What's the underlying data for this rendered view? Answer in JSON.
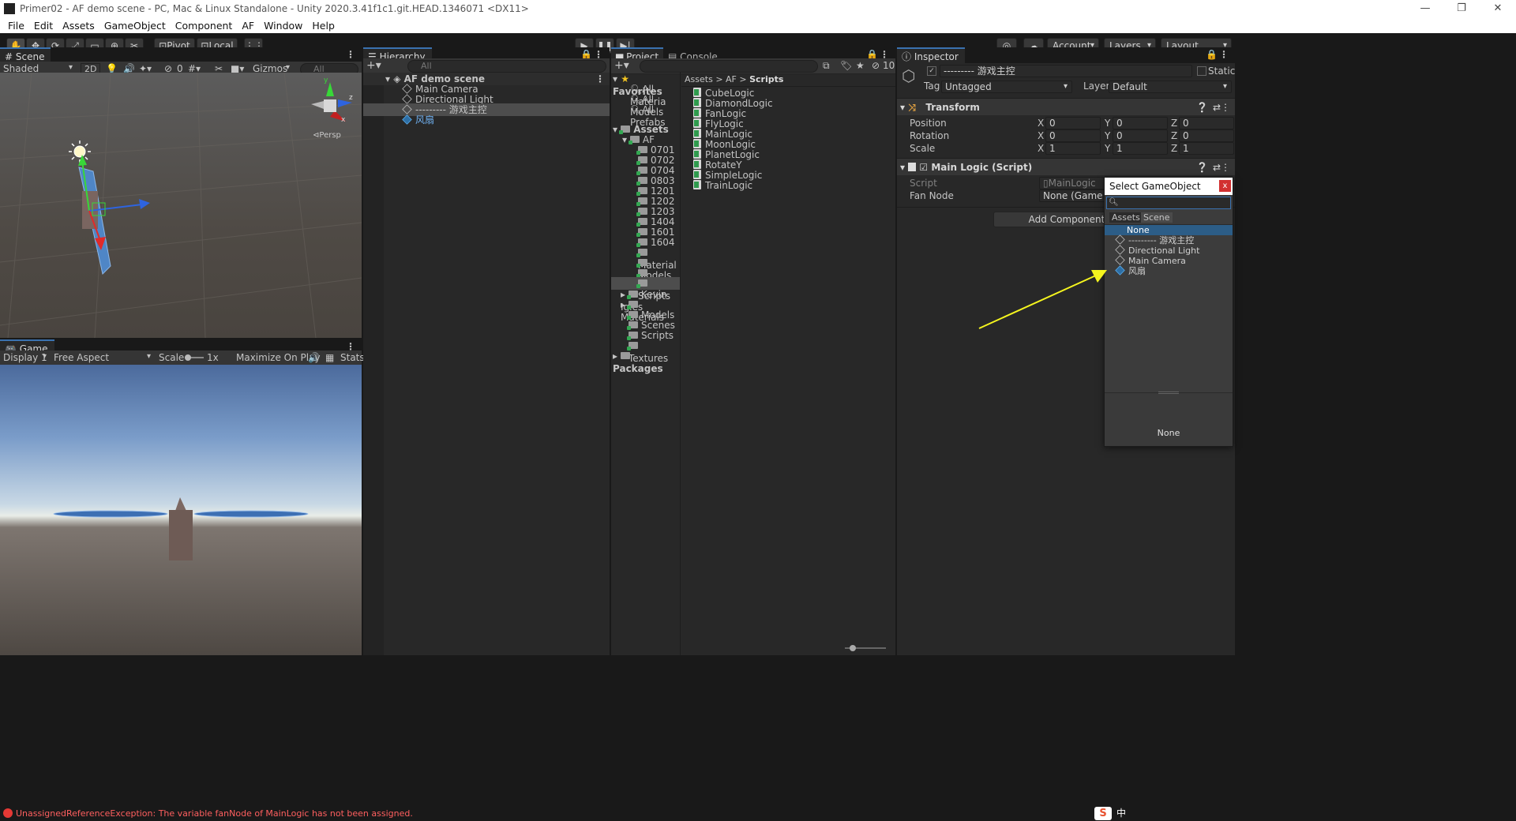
{
  "window": {
    "title": "Primer02 - AF demo scene - PC, Mac & Linux Standalone - Unity 2020.3.41f1c1.git.HEAD.1346071 <DX11>",
    "controls": [
      "—",
      "❐",
      "✕"
    ]
  },
  "menu": [
    "File",
    "Edit",
    "Assets",
    "GameObject",
    "Component",
    "AF",
    "Window",
    "Help"
  ],
  "toolbar": {
    "pivot": "Pivot",
    "local": "Local",
    "account": "Account",
    "layers": "Layers",
    "layout": "Layout"
  },
  "scene": {
    "tab": "Scene",
    "shading": "Shaded",
    "mode_2d": "2D",
    "hidden_count": "0",
    "gizmos": "Gizmos",
    "search_placeholder": "All",
    "persp": "Persp",
    "axes": {
      "y": "y",
      "x": "x",
      "z": "z"
    }
  },
  "game": {
    "tab": "Game",
    "display": "Display 1",
    "aspect": "Free Aspect",
    "scale_label": "Scale",
    "scale_value": "1x",
    "maximize": "Maximize On Play",
    "stats": "Stats"
  },
  "hierarchy": {
    "tab": "Hierarchy",
    "search_placeholder": "All",
    "scene_name": "AF demo scene",
    "items": [
      "Main Camera",
      "Directional Light",
      "--------- 游戏主控",
      "风扇"
    ]
  },
  "project": {
    "tab": "Project",
    "console_tab": "Console",
    "hidden_count": "10",
    "favorites_label": "Favorites",
    "favorites": [
      "All Materia",
      "All Models",
      "All Prefabs"
    ],
    "assets_label": "Assets",
    "af_label": "AF",
    "af_folders": [
      "0701",
      "0702",
      "0704",
      "0803",
      "1201",
      "1202",
      "1203",
      "1404",
      "1601",
      "1604",
      "Material",
      "Models",
      "Scenes",
      "Scripts"
    ],
    "asset_folders": [
      "Kevin Igles",
      "Materials",
      "Models",
      "Scenes",
      "Scripts",
      "Textures"
    ],
    "packages_label": "Packages",
    "breadcrumb": [
      "Assets",
      "AF",
      "Scripts"
    ],
    "breadcrumb_sep": ">",
    "files": [
      "CubeLogic",
      "DiamondLogic",
      "FanLogic",
      "FlyLogic",
      "MainLogic",
      "MoonLogic",
      "PlanetLogic",
      "RotateY",
      "SimpleLogic",
      "TrainLogic"
    ]
  },
  "inspector": {
    "tab": "Inspector",
    "object_name": "--------- 游戏主控",
    "static_label": "Static",
    "tag_label": "Tag",
    "tag_value": "Untagged",
    "layer_label": "Layer",
    "layer_value": "Default",
    "transform": {
      "title": "Transform",
      "position_label": "Position",
      "rotation_label": "Rotation",
      "scale_label": "Scale",
      "position": {
        "x": "0",
        "y": "0",
        "z": "0"
      },
      "rotation": {
        "x": "0",
        "y": "0",
        "z": "0"
      },
      "scale": {
        "x": "1",
        "y": "1",
        "z": "1"
      },
      "axis_x": "X",
      "axis_y": "Y",
      "axis_z": "Z"
    },
    "script_component": {
      "title": "Main Logic (Script)",
      "script_label": "Script",
      "script_value": "MainLogic",
      "fan_node_label": "Fan Node",
      "fan_node_value": "None (Game Obje"
    },
    "add_component": "Add Component"
  },
  "popup": {
    "title": "Select GameObject",
    "close": "x",
    "tabs": [
      "Assets",
      "Scene"
    ],
    "items": [
      "None",
      "--------- 游戏主控",
      "Directional Light",
      "Main Camera",
      "风扇"
    ],
    "preview_label": "None"
  },
  "status": {
    "message": "UnassignedReferenceException: The variable fanNode of MainLogic has not been assigned."
  },
  "ime": {
    "label": "中"
  },
  "colors": {
    "accent": "#3a72b0",
    "selection": "#2c5d87",
    "error": "#ff5f5f",
    "arrow": "#f5f51e"
  }
}
